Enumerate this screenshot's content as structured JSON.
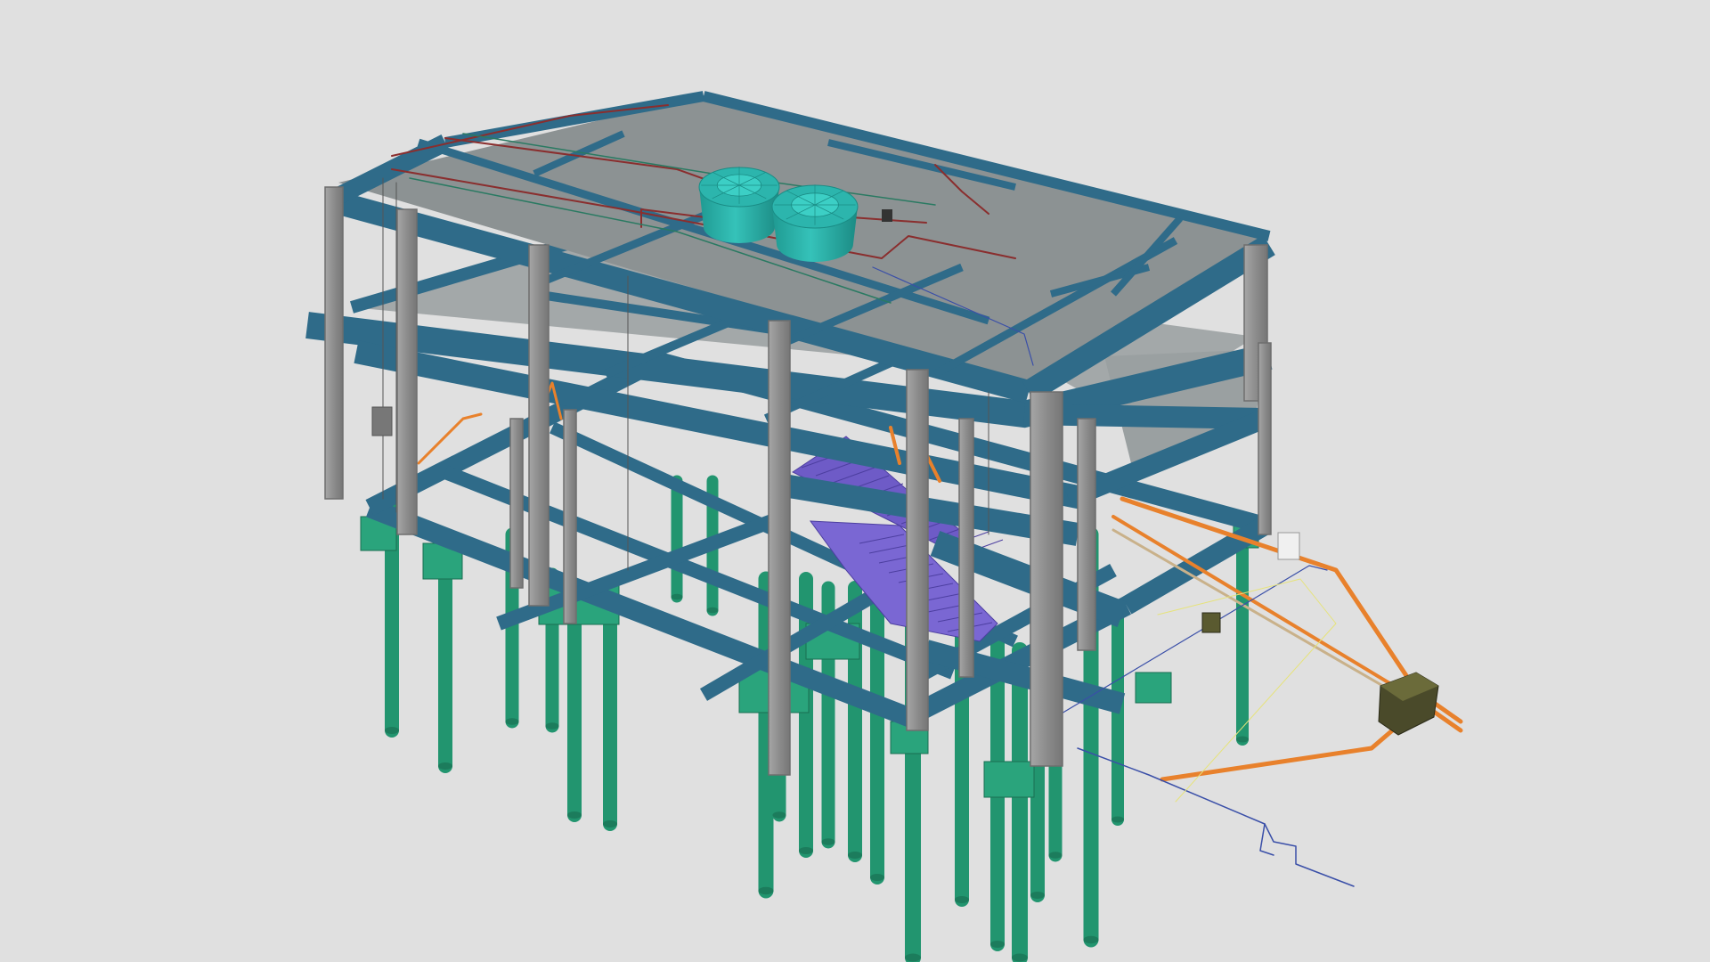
{
  "colors": {
    "background": "#e0e0e0",
    "pile": "#22956f",
    "pile_cap": "#2aa47c",
    "beam": "#2f6b89",
    "beam_top": "#3f88aa",
    "slab": "#8f9596",
    "slab_lower": "#9ea3a4",
    "column": "#8a8a8a",
    "column_light": "#a9a9a9",
    "water_tank": "#2cb5ad",
    "stair": "#6e5bc7",
    "sewer_pipe": "#e8812c",
    "water_pipe_hot": "#8a2e2e",
    "water_pipe_cold": "#2a7a62",
    "electrical_line": "#3a4fa8",
    "gas_line": "#e6e37a",
    "inspection_box": "#4a4a2a",
    "meter_box": "#f0f0f0"
  },
  "icons": {
    "water_tank": "water-tank-icon",
    "inspection_box": "inspection-box-icon",
    "meter_box": "meter-box-icon",
    "electrical_panel": "electrical-panel-icon"
  }
}
